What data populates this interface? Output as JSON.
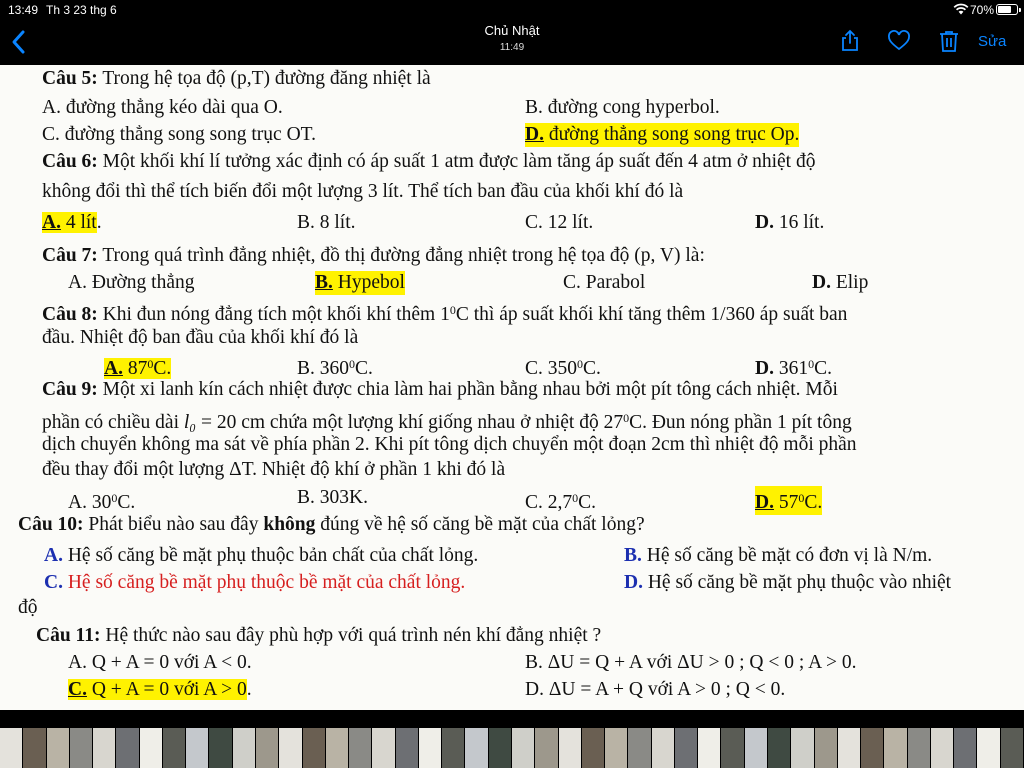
{
  "status": {
    "time": "13:49",
    "date": "Th 3 23 thg 6",
    "battery_pct": "70%",
    "battery_level": 0.7
  },
  "nav": {
    "title": "Chủ Nhật",
    "subtitle": "11:49",
    "edit_label": "Sửa",
    "accent": "#0a84ff"
  },
  "doc": {
    "q5": {
      "num": "Câu 5:",
      "text": " Trong hệ tọa độ (p,T) đường đăng nhiệt là",
      "a": "A. đường thẳng kéo dài qua O.",
      "b": "B. đường cong hyperbol.",
      "c": "C. đường thẳng song song trục OT.",
      "d_letter": "D.",
      "d": " đường thẳng song song trục Op."
    },
    "q6": {
      "num": "Câu 6:",
      "text1": " Một khối khí lí tưởng xác định có áp suất 1 atm được làm tăng áp suất đến 4 atm ở nhiệt độ",
      "text2": "không đổi thì thể tích biến đổi một lượng 3 lít. Thể tích ban đầu của khối khí đó là",
      "a_letter": "A.",
      "a": " 4 lít",
      "a_tail": ".",
      "b": "B. 8 lít.",
      "c": "C. 12 lít.",
      "d_letter": "D.",
      "d": " 16 lít."
    },
    "q7": {
      "num": "Câu 7:",
      "text": " Trong quá trình đẳng nhiệt, đồ thị đường đẳng nhiệt trong hệ tọa độ (p, V) là:",
      "a": "A. Đường thẳng",
      "b_letter": "B.",
      "b": " Hypebol",
      "c": "C. Parabol",
      "d_letter": "D.",
      "d": " Elip"
    },
    "q8": {
      "num": "Câu 8:",
      "text1a": " Khi đun nóng đẳng tích một khối khí thêm 1",
      "sup": "0",
      "text1b": "C thì áp suất khối khí tăng thêm 1/360 áp suất ban",
      "text2": "đầu. Nhiệt độ ban đầu của khối khí đó là",
      "a_letter": "A.",
      "a": " 87",
      "b": "B. 360",
      "c": "C. 350",
      "d_letter": "D.",
      "d": " 361",
      "deg_unit": "C",
      "period": "."
    },
    "q9": {
      "num": "Câu 9:",
      "text1": " Một xi lanh kín cách nhiệt được chia làm hai phần bằng nhau bởi một pít tông cách nhiệt. Mỗi",
      "text2a": "phần có chiều dài ",
      "l0": "l₀",
      "text2b": " = 20 cm chứa một lượng khí giống nhau ở nhiệt độ 27",
      "text2c": "C. Đun nóng phần 1 pít tông",
      "text3": "dịch chuyển không ma sát về phía phần 2. Khi pít tông dịch chuyển một đoạn 2cm thì nhiệt độ mỗi phần",
      "text4": "đều thay đổi một lượng ΔT. Nhiệt độ khí ở phần 1 khi đó là",
      "a": "A. 30",
      "b": "B. 303K.",
      "c": "C. 2,7",
      "d_letter": "D.",
      "d": " 57"
    },
    "q10": {
      "num": "Câu 10:",
      "text_a": " Phát biểu nào sau đây ",
      "bold": "không",
      "text_b": " đúng về hệ số căng bề mặt của chất lỏng?",
      "a_letter": "A.",
      "a": " Hệ số căng bề mặt phụ thuộc bản chất của chất lỏng.",
      "b_letter": "B.",
      "b": " Hệ số căng bề mặt có đơn vị là N/m.",
      "c_letter": "C.",
      "c": " Hệ số căng bề mặt phụ thuộc bề mặt của chất lỏng.",
      "d_letter": "D.",
      "d": " Hệ số căng bề mặt phụ thuộc vào nhiệt",
      "d_cont": "độ"
    },
    "q11": {
      "num": "Câu 11:",
      "text": " Hệ thức nào sau đây phù hợp với quá trình nén khí đẳng nhiệt ?",
      "a": "A. Q + A = 0 với A < 0.",
      "b": "B. ΔU = Q + A với ΔU > 0 ; Q < 0 ; A > 0.",
      "c_letter": "C.",
      "c": " Q + A = 0 với A > 0",
      "c_tail": ".",
      "d": "D. ΔU = A + Q với A > 0 ; Q < 0."
    }
  },
  "colors": {
    "highlight": "#fff200",
    "blue_text": "#1c2fb0",
    "red_text": "#d61f1f"
  },
  "thumbnails": {
    "count": 44
  }
}
